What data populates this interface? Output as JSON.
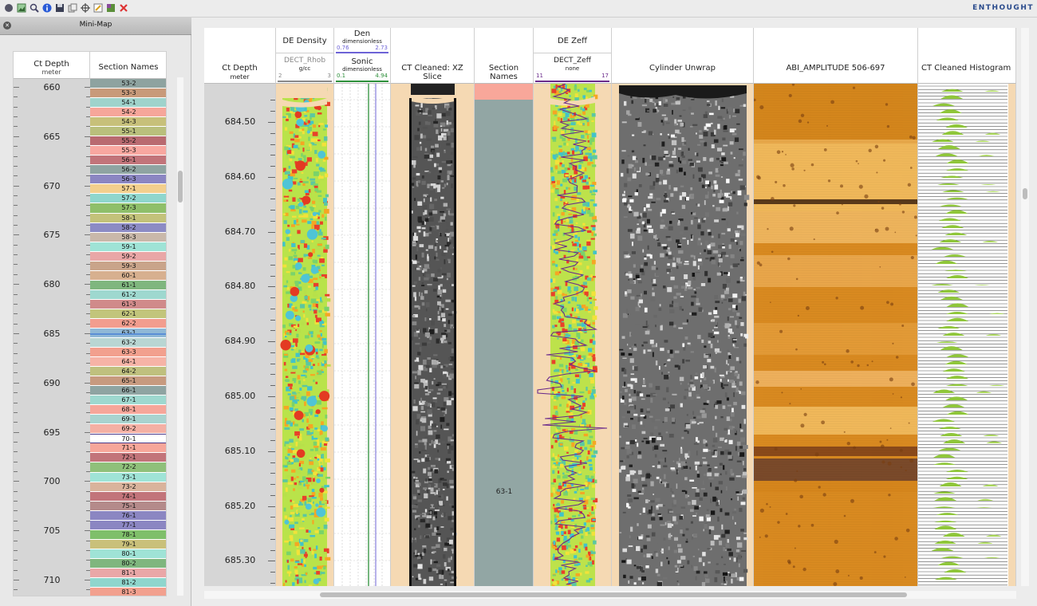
{
  "toolbar": {
    "icons": [
      "circle-icon",
      "image-icon",
      "zoom-icon",
      "info-icon",
      "save-icon",
      "copy-icon",
      "crosshair-icon",
      "edit-icon",
      "color-icon",
      "close-icon"
    ],
    "brand": "ENTHOUGHT"
  },
  "minimap": {
    "title": "Mini-Map",
    "depth_header": "Ct Depth",
    "depth_unit": "meter",
    "sections_header": "Section Names",
    "depth_labels": [
      "660",
      "665",
      "670",
      "675",
      "680",
      "685",
      "690",
      "695",
      "700",
      "705",
      "710"
    ],
    "sections": [
      {
        "name": "53-2",
        "color": "#8ea3a0"
      },
      {
        "name": "53-3",
        "color": "#c89a7a"
      },
      {
        "name": "54-1",
        "color": "#9fd3cc"
      },
      {
        "name": "54-2",
        "color": "#f6a69a"
      },
      {
        "name": "54-3",
        "color": "#c7c07a"
      },
      {
        "name": "55-1",
        "color": "#b9bf7c"
      },
      {
        "name": "55-2",
        "color": "#b96a70"
      },
      {
        "name": "55-3",
        "color": "#f8a7a0"
      },
      {
        "name": "56-1",
        "color": "#c2747a"
      },
      {
        "name": "56-2",
        "color": "#8fa4a2"
      },
      {
        "name": "56-3",
        "color": "#8b86c2"
      },
      {
        "name": "57-1",
        "color": "#f2cf8e"
      },
      {
        "name": "57-2",
        "color": "#8fd6cd"
      },
      {
        "name": "57-3",
        "color": "#8fbf6a"
      },
      {
        "name": "58-1",
        "color": "#c3c27a"
      },
      {
        "name": "58-2",
        "color": "#8c8bc4"
      },
      {
        "name": "58-3",
        "color": "#c9b8aa"
      },
      {
        "name": "59-1",
        "color": "#9fe3d6"
      },
      {
        "name": "59-2",
        "color": "#e9a7a7"
      },
      {
        "name": "59-3",
        "color": "#c9a48a"
      },
      {
        "name": "60-1",
        "color": "#d7b08f"
      },
      {
        "name": "61-1",
        "color": "#7fb67e"
      },
      {
        "name": "61-2",
        "color": "#9ed8cf"
      },
      {
        "name": "61-3",
        "color": "#d08a8a"
      },
      {
        "name": "62-1",
        "color": "#c2c57b"
      },
      {
        "name": "62-2",
        "color": "#f29d8e"
      },
      {
        "name": "63-1",
        "color": "#8fb8d6"
      },
      {
        "name": "63-2",
        "color": "#b9d6d3"
      },
      {
        "name": "63-3",
        "color": "#f2a08e"
      },
      {
        "name": "64-1",
        "color": "#f6b3a6"
      },
      {
        "name": "64-2",
        "color": "#bfc07e"
      },
      {
        "name": "65-1",
        "color": "#c79a7f"
      },
      {
        "name": "66-1",
        "color": "#8fa4a2"
      },
      {
        "name": "67-1",
        "color": "#9ed8cf"
      },
      {
        "name": "68-1",
        "color": "#f6a69a"
      },
      {
        "name": "69-1",
        "color": "#a9d3cf"
      },
      {
        "name": "69-2",
        "color": "#f4b0a4"
      },
      {
        "name": "70-1",
        "color": "#ffffff"
      },
      {
        "name": "71-1",
        "color": "#f6a69a"
      },
      {
        "name": "72-1",
        "color": "#c2747a"
      },
      {
        "name": "72-2",
        "color": "#8fc07a"
      },
      {
        "name": "73-1",
        "color": "#9fe3d6"
      },
      {
        "name": "73-2",
        "color": "#d9b39c"
      },
      {
        "name": "74-1",
        "color": "#c2747a"
      },
      {
        "name": "75-1",
        "color": "#b48a8a"
      },
      {
        "name": "76-1",
        "color": "#8b86c2"
      },
      {
        "name": "77-1",
        "color": "#8b86c2"
      },
      {
        "name": "78-1",
        "color": "#7fbf6a"
      },
      {
        "name": "79-1",
        "color": "#c9c07a"
      },
      {
        "name": "80-1",
        "color": "#9fe3d6"
      },
      {
        "name": "80-2",
        "color": "#7fb67e"
      },
      {
        "name": "81-1",
        "color": "#e9a7a7"
      },
      {
        "name": "81-2",
        "color": "#8fd6cd"
      },
      {
        "name": "81-3",
        "color": "#f2a08e"
      }
    ]
  },
  "tracks": {
    "depth": {
      "title": "Ct Depth",
      "unit": "meter",
      "labels": [
        "684.50",
        "684.60",
        "684.70",
        "684.80",
        "684.90",
        "685.00",
        "685.10",
        "685.20",
        "685.30"
      ]
    },
    "density": {
      "title": "DE Density",
      "curve": "DECT_Rhob",
      "unit": "g/cc",
      "min": "2",
      "max": "3",
      "curve_color": "#888888"
    },
    "den_sonic": {
      "den_title": "Den",
      "den_unit": "dimensionless",
      "den_min": "0.76",
      "den_max": "2.73",
      "den_color": "#6d63d6",
      "sonic_title": "Sonic",
      "sonic_unit": "dimensionless",
      "sonic_min": "0.1",
      "sonic_max": "4.94",
      "sonic_color": "#2d8f3a"
    },
    "ct_slice": {
      "title": "CT Cleaned: XZ Slice"
    },
    "section_names": {
      "title": "Section Names",
      "value": "63-1"
    },
    "zeff": {
      "title": "DE Zeff",
      "curve": "DECT_Zeff",
      "unit": "none",
      "min": "11",
      "max": "17",
      "curve_color": "#6a2a8a"
    },
    "unwrap": {
      "title": "Cylinder Unwrap"
    },
    "abi": {
      "title": "ABI_AMPLITUDE 506-697"
    },
    "histogram": {
      "title": "CT Cleaned Histogram"
    }
  }
}
